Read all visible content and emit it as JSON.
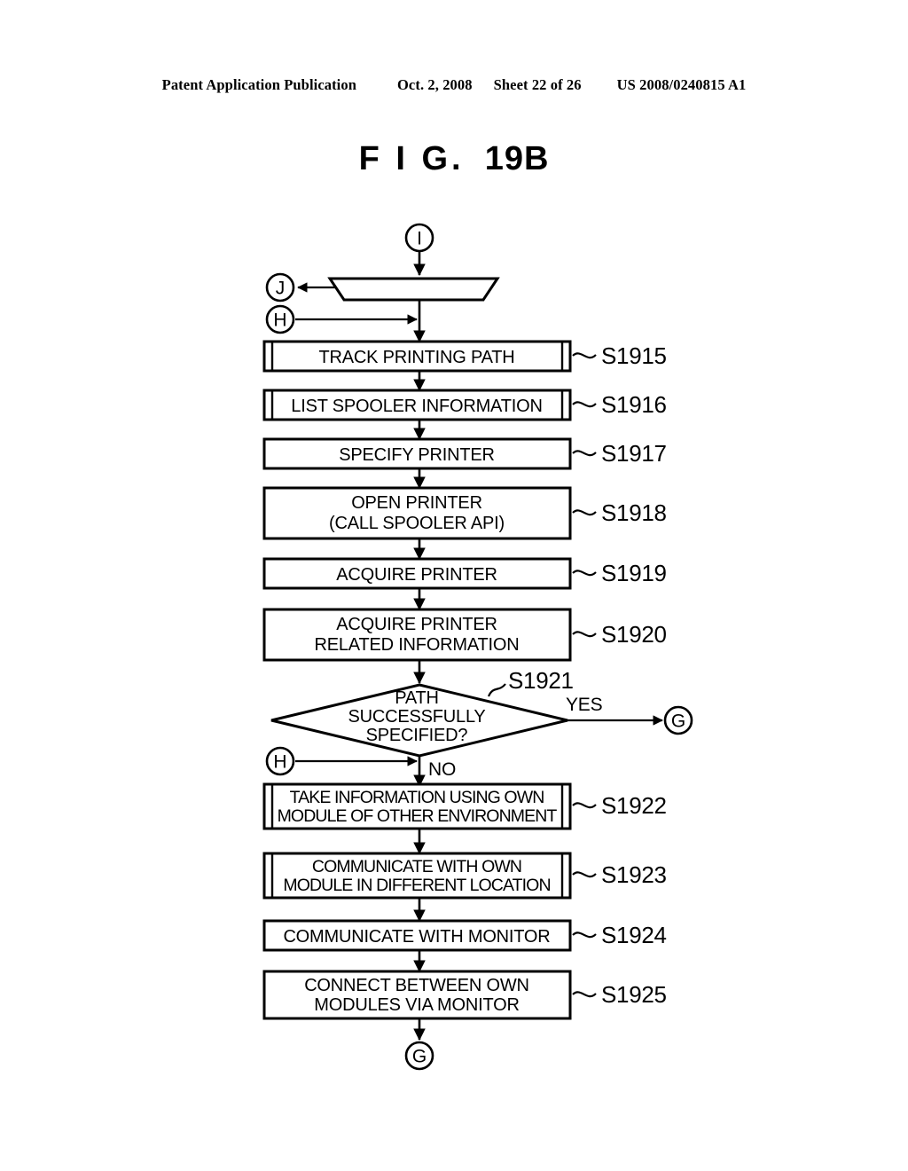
{
  "header": {
    "publication": "Patent Application Publication",
    "date": "Oct. 2, 2008",
    "sheet": "Sheet 22 of 26",
    "patent_number": "US 2008/0240815 A1"
  },
  "figure": {
    "label_fig": "F I G.",
    "label_number": "19B"
  },
  "chart_data": {
    "type": "diagram",
    "title": "F I G. 19B",
    "diagram_kind": "flowchart",
    "connectors": [
      {
        "id": "in-I",
        "label": "I",
        "role": "entry-top"
      },
      {
        "id": "out-J",
        "label": "J",
        "role": "exit-left"
      },
      {
        "id": "in-H-top",
        "label": "H",
        "role": "entry-left"
      },
      {
        "id": "out-G-yes",
        "label": "G",
        "role": "exit-right"
      },
      {
        "id": "in-H-bottom",
        "label": "H",
        "role": "entry-left"
      },
      {
        "id": "out-G-end",
        "label": "G",
        "role": "exit-bottom"
      }
    ],
    "nodes": [
      {
        "id": "trapezoid",
        "shape": "trapezoid",
        "text": [
          ""
        ],
        "step": ""
      },
      {
        "id": "s1915",
        "shape": "predefined-process",
        "text": [
          "TRACK PRINTING PATH"
        ],
        "step": "S1915"
      },
      {
        "id": "s1916",
        "shape": "predefined-process",
        "text": [
          "LIST SPOOLER INFORMATION"
        ],
        "step": "S1916"
      },
      {
        "id": "s1917",
        "shape": "process",
        "text": [
          "SPECIFY PRINTER"
        ],
        "step": "S1917"
      },
      {
        "id": "s1918",
        "shape": "process",
        "text": [
          "OPEN PRINTER",
          "(CALL SPOOLER API)"
        ],
        "step": "S1918"
      },
      {
        "id": "s1919",
        "shape": "process",
        "text": [
          "ACQUIRE PRINTER"
        ],
        "step": "S1919"
      },
      {
        "id": "s1920",
        "shape": "process",
        "text": [
          "ACQUIRE PRINTER",
          "RELATED INFORMATION"
        ],
        "step": "S1920"
      },
      {
        "id": "s1921",
        "shape": "decision",
        "text": [
          "PATH",
          "SUCCESSFULLY",
          "SPECIFIED?"
        ],
        "step": "S1921"
      },
      {
        "id": "s1922",
        "shape": "predefined-process",
        "text": [
          "TAKE INFORMATION USING OWN",
          "MODULE OF OTHER ENVIRONMENT"
        ],
        "step": "S1922"
      },
      {
        "id": "s1923",
        "shape": "predefined-process",
        "text": [
          "COMMUNICATE WITH OWN",
          "MODULE IN DIFFERENT LOCATION"
        ],
        "step": "S1923"
      },
      {
        "id": "s1924",
        "shape": "process",
        "text": [
          "COMMUNICATE WITH MONITOR"
        ],
        "step": "S1924"
      },
      {
        "id": "s1925",
        "shape": "process",
        "text": [
          "CONNECT BETWEEN OWN",
          "MODULES VIA MONITOR"
        ],
        "step": "S1925"
      }
    ],
    "branch_labels": {
      "yes": "YES",
      "no": "NO"
    }
  },
  "flow": {
    "connector_I": "I",
    "connector_J": "J",
    "connector_H_top": "H",
    "connector_H_bottom": "H",
    "connector_G_yes": "G",
    "connector_G_end": "G",
    "yes_label": "YES",
    "no_label": "NO",
    "boxes": {
      "s1915": {
        "line1": "TRACK PRINTING PATH",
        "step": "S1915"
      },
      "s1916": {
        "line1": "LIST SPOOLER INFORMATION",
        "step": "S1916"
      },
      "s1917": {
        "line1": "SPECIFY PRINTER",
        "step": "S1917"
      },
      "s1918": {
        "line1": "OPEN PRINTER",
        "line2": "(CALL SPOOLER API)",
        "step": "S1918"
      },
      "s1919": {
        "line1": "ACQUIRE PRINTER",
        "step": "S1919"
      },
      "s1920": {
        "line1": "ACQUIRE PRINTER",
        "line2": "RELATED INFORMATION",
        "step": "S1920"
      },
      "s1921": {
        "line1": "PATH",
        "line2": "SUCCESSFULLY",
        "line3": "SPECIFIED?",
        "step": "S1921"
      },
      "s1922": {
        "line1": "TAKE INFORMATION USING OWN",
        "line2": "MODULE OF OTHER ENVIRONMENT",
        "step": "S1922"
      },
      "s1923": {
        "line1": "COMMUNICATE WITH OWN",
        "line2": "MODULE IN DIFFERENT LOCATION",
        "step": "S1923"
      },
      "s1924": {
        "line1": "COMMUNICATE WITH MONITOR",
        "step": "S1924"
      },
      "s1925": {
        "line1": "CONNECT BETWEEN OWN",
        "line2": "MODULES VIA MONITOR",
        "step": "S1925"
      }
    }
  }
}
